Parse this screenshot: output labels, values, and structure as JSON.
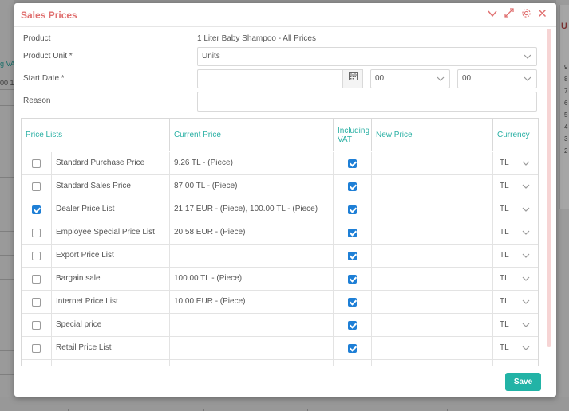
{
  "background": {
    "left_fragments": [
      "g VA",
      "00 1"
    ],
    "right_heading": "U",
    "right_numbers": [
      "9",
      "8",
      "7",
      "6",
      "5",
      "4",
      "3",
      "2"
    ]
  },
  "modal": {
    "title": "Sales Prices",
    "header_icons": [
      "chevron-down-icon",
      "expand-icon",
      "gear-icon",
      "close-icon"
    ]
  },
  "form": {
    "product_label": "Product",
    "product_value": "1 Liter Baby Shampoo - All Prices",
    "product_unit_label": "Product Unit *",
    "product_unit_value": "Units",
    "start_date_label": "Start Date *",
    "start_date_value": "",
    "hour_value": "00",
    "minute_value": "00",
    "reason_label": "Reason",
    "reason_value": ""
  },
  "table": {
    "headers": {
      "price_lists": "Price Lists",
      "current_price": "Current Price",
      "including_vat_1": "Including",
      "including_vat_2": "VAT",
      "new_price": "New Price",
      "currency": "Currency"
    },
    "rows": [
      {
        "checked": false,
        "name": "Standard Purchase Price",
        "current_price": "9.26 TL - (Piece)",
        "vat": true,
        "new_price": "",
        "currency": "TL"
      },
      {
        "checked": false,
        "name": "Standard Sales Price",
        "current_price": "87.00 TL - (Piece)",
        "vat": true,
        "new_price": "",
        "currency": "TL"
      },
      {
        "checked": true,
        "name": "Dealer Price List",
        "current_price": "21.17 EUR - (Piece), 100.00 TL - (Piece)",
        "vat": true,
        "new_price": "",
        "currency": "TL"
      },
      {
        "checked": false,
        "name": "Employee Special Price List",
        "current_price": "20,58 EUR - (Piece)",
        "vat": true,
        "new_price": "",
        "currency": "TL"
      },
      {
        "checked": false,
        "name": "Export Price List",
        "current_price": "",
        "vat": true,
        "new_price": "",
        "currency": "TL"
      },
      {
        "checked": false,
        "name": "Bargain sale",
        "current_price": "100.00 TL - (Piece)",
        "vat": true,
        "new_price": "",
        "currency": "TL"
      },
      {
        "checked": false,
        "name": "Internet Price List",
        "current_price": "10.00 EUR - (Piece)",
        "vat": true,
        "new_price": "",
        "currency": "TL"
      },
      {
        "checked": false,
        "name": "Special price",
        "current_price": "",
        "vat": true,
        "new_price": "",
        "currency": "TL"
      },
      {
        "checked": false,
        "name": "Retail Price List",
        "current_price": "",
        "vat": true,
        "new_price": "",
        "currency": "TL"
      }
    ]
  },
  "actions": {
    "save_label": "Save"
  },
  "colors": {
    "title": "#e07070",
    "accent": "#22b3a6",
    "checkbox": "#1e7fd6"
  }
}
